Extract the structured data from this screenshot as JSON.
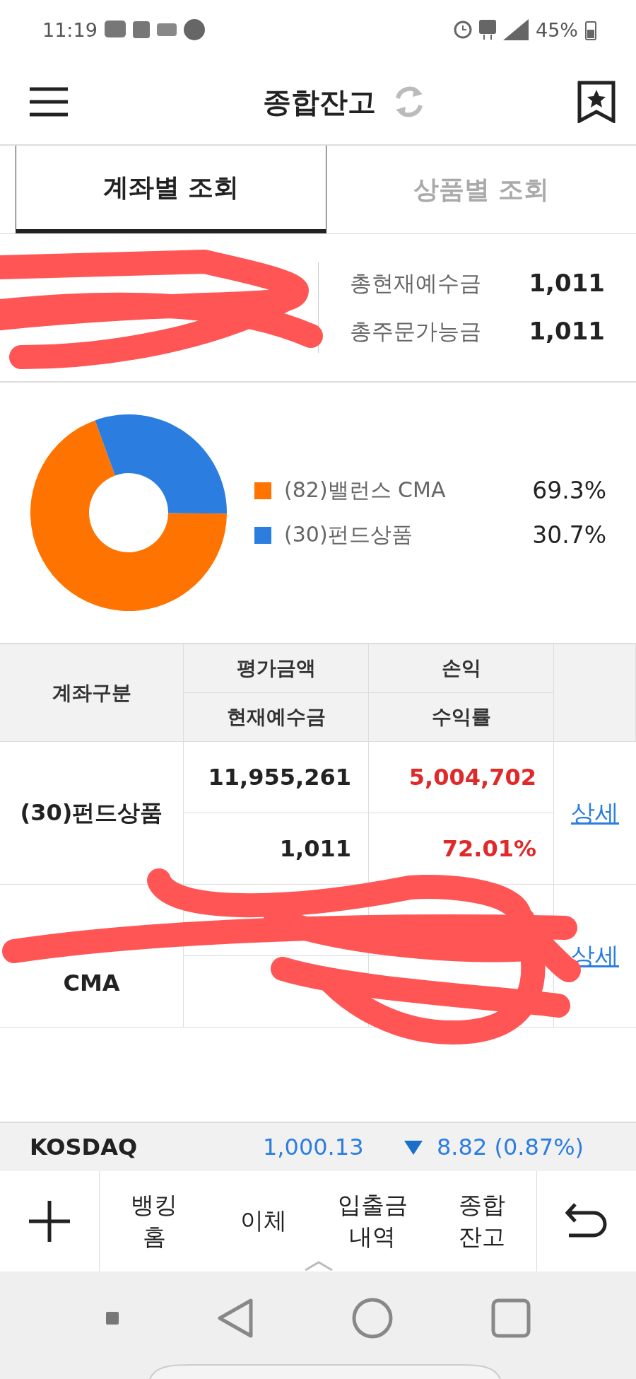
{
  "status_bar": {
    "time": "11:19",
    "battery": "45%"
  },
  "header": {
    "title": "종합잔고"
  },
  "tabs": [
    {
      "label": "계좌별 조회",
      "selected": true
    },
    {
      "label": "상품별 조회",
      "selected": false
    }
  ],
  "summary": [
    {
      "label": "총현재예수금",
      "value": "1,011"
    },
    {
      "label": "총주문가능금",
      "value": "1,011"
    }
  ],
  "chart": {
    "chart_data": {
      "type": "donut",
      "categories": [
        "(82)밸런스 CMA",
        "(30)펀드상품"
      ],
      "values": [
        69.3,
        30.7
      ]
    },
    "legend": [
      {
        "color": "#ff7300",
        "percent": "69.3%"
      },
      {
        "color": "#2b7de0",
        "percent": "30.7%"
      }
    ]
  },
  "table": {
    "columns": [
      "계좌구분",
      "평가금액",
      "현재예수금",
      "손익",
      "수익률"
    ],
    "rows": [
      {
        "account": "(30)펀드상품",
        "valuation": "11,955,261",
        "deposit": "1,011",
        "profit": "5,004,702",
        "rate": "72.01%",
        "detail": "상세"
      },
      {
        "account": "CMA",
        "detail": "상세"
      }
    ]
  },
  "ticker": {
    "name": "KOSDAQ",
    "price": "1,000.13",
    "change": "8.82 (0.87%)"
  },
  "bottom_nav": [
    "뱅킹\n홈",
    "이체",
    "입출금\n내역",
    "종합\n잔고"
  ]
}
